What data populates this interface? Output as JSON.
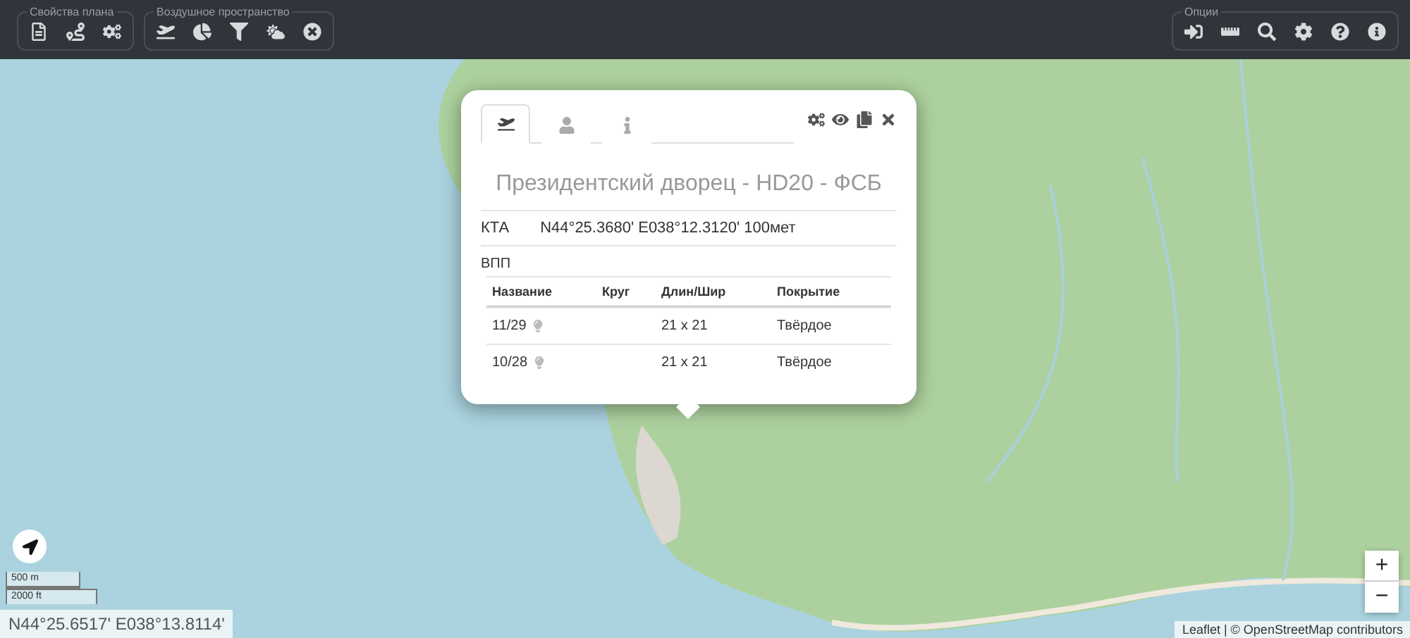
{
  "toolbar": {
    "left_groups": [
      {
        "legend": "Свойства плана"
      },
      {
        "legend": "Воздушное пространство"
      }
    ],
    "right_groups": [
      {
        "legend": "Опции"
      }
    ]
  },
  "popup": {
    "tabs": [
      {
        "selected": true
      },
      {
        "selected": false
      },
      {
        "selected": false
      }
    ],
    "title": "Президентский дворец - HD20 - ФСБ",
    "kta": {
      "label": "КТА",
      "value": "N44°25.3680' E038°12.3120' 100мет"
    },
    "runways_label": "ВПП",
    "columns": [
      "Название",
      "Круг",
      "Длин/Шир",
      "Покрытие"
    ],
    "rows": [
      {
        "name": "11/29",
        "circuit": "",
        "size": "21 x 21",
        "surface": "Твёрдое"
      },
      {
        "name": "10/28",
        "circuit": "",
        "size": "21 x 21",
        "surface": "Твёрдое"
      }
    ]
  },
  "scale": [
    "500 m",
    "2000 ft"
  ],
  "coordinates": "N44°25.6517' E038°13.8114'",
  "zoom": [
    "+",
    "−"
  ],
  "attribution": "Leaflet | © OpenStreetMap contributors"
}
